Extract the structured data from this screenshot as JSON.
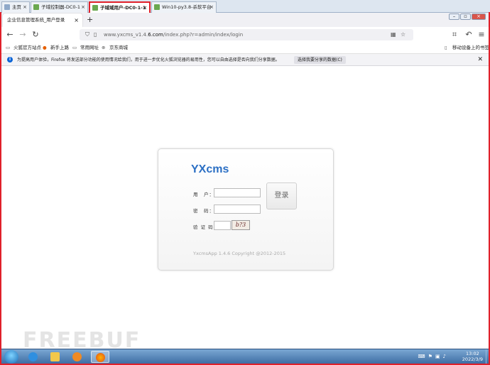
{
  "vm_tabs": [
    {
      "label": "主页"
    },
    {
      "label": "子域控制器-DC0-1"
    },
    {
      "label": "子域域用户-DC0-1-1"
    },
    {
      "label": "Win10-py3.8-杀软平台"
    }
  ],
  "browser_tab": {
    "title": "企业信息管理系统_用户登录"
  },
  "url": {
    "prefix": "www.yxcms_v1.4.",
    "host": "6.com",
    "path": "/index.php?r=admin/index/login"
  },
  "bookmarks": [
    {
      "label": "火狐官方站点",
      "icon": "folder-icon"
    },
    {
      "label": "新手上路",
      "icon": "firefox-icon"
    },
    {
      "label": "常用网址",
      "icon": "folder-icon"
    },
    {
      "label": "京东商城",
      "icon": "globe-icon"
    }
  ],
  "mobile_bookmarks": "移动设备上的书签",
  "notification": {
    "message": "为提高用户体验，Firefox 将发送部分功能的使用情况给我们，用于进一步优化火狐浏览器的易用性，您可以自由选择是否向我们分享数据。",
    "button": "选择我要分享的数据(C)"
  },
  "login": {
    "logo": "YXcms",
    "username_label": "用　户：",
    "password_label": "密　码：",
    "captcha_label": "验 证 码：",
    "captcha_text": "b?3",
    "submit": "登录",
    "copyright": "YxcmsApp 1.4.6 Copyright @2012-2015"
  },
  "watermark": "FREEBUF",
  "clock": {
    "time": "13:02",
    "date": "2022/3/9"
  },
  "colors": {
    "accent_red": "#e0202a",
    "logo_blue": "#2b6fc4"
  }
}
